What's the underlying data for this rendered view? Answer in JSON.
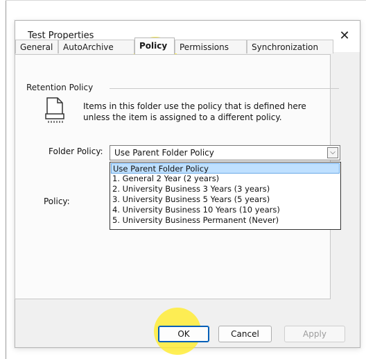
{
  "dialog": {
    "title": "Test Properties",
    "close_glyph": "✕"
  },
  "tabs": [
    {
      "label": "General"
    },
    {
      "label": "AutoArchive"
    },
    {
      "label": "Policy"
    },
    {
      "label": "Permissions"
    },
    {
      "label": "Synchronization"
    }
  ],
  "active_tab": "Policy",
  "retention": {
    "group_label": "Retention Policy",
    "icon": "document-printer-icon",
    "info_text": "Items in this folder use the policy that is defined here unless the item is assigned to a different policy."
  },
  "folder_policy": {
    "label": "Folder Policy:",
    "value": "Use Parent Folder Policy",
    "arrow_glyph": "⌵"
  },
  "policy_label": "Policy:",
  "dropdown_options": [
    "Use Parent Folder Policy",
    "1. General 2 Year (2 years)",
    "2. University Business 3 Years (3 years)",
    "3. University Business 5 Years (5 years)",
    "4. University Business 10 Years (10 years)",
    "5. University Business Permanent (Never)"
  ],
  "buttons": {
    "ok": "OK",
    "cancel": "Cancel",
    "apply": "Apply"
  },
  "colors": {
    "highlight": "#ffeb30",
    "selection": "#bfe0ff",
    "accent": "#005fb8"
  }
}
